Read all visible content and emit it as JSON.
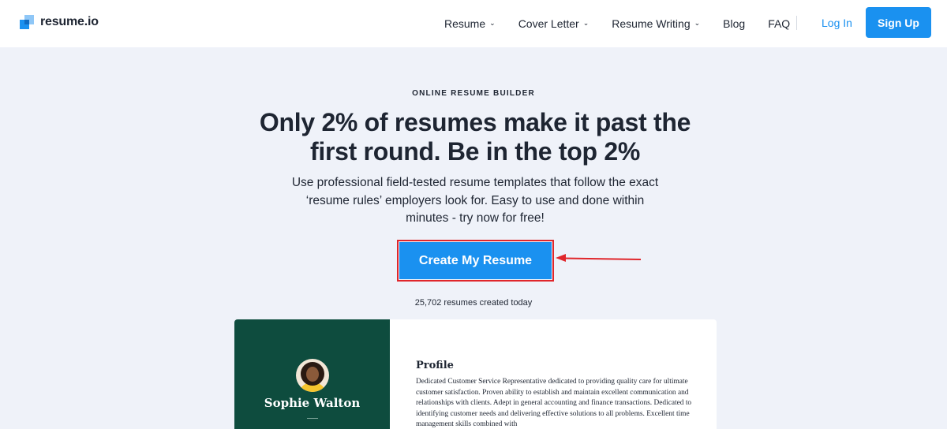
{
  "brand": {
    "name": "resume.io"
  },
  "nav": {
    "items": [
      {
        "label": "Resume",
        "has_dropdown": true
      },
      {
        "label": "Cover Letter",
        "has_dropdown": true
      },
      {
        "label": "Resume Writing",
        "has_dropdown": true
      },
      {
        "label": "Blog",
        "has_dropdown": false
      },
      {
        "label": "FAQ",
        "has_dropdown": false
      }
    ],
    "login_label": "Log In",
    "signup_label": "Sign Up"
  },
  "hero": {
    "eyebrow": "ONLINE RESUME BUILDER",
    "headline": "Only 2% of resumes make it past the first round. Be in the top 2%",
    "subtext": "Use professional field-tested resume templates that follow the exact ‘resume rules’ employers look for. Easy to use and done within minutes - try now for free!",
    "cta_label": "Create My Resume",
    "counter_text": "25,702 resumes created today"
  },
  "preview": {
    "person_name": "Sophie Walton",
    "profile_heading": "Profile",
    "profile_text": "Dedicated Customer Service Representative dedicated to providing quality care for ultimate customer satisfaction. Proven ability to establish and maintain excellent communication and relationships with clients. Adept in general accounting and finance transactions. Dedicated to identifying customer needs and delivering effective solutions to all problems. Excellent time management skills combined with"
  },
  "colors": {
    "accent": "#1a91f0",
    "page_bg": "#eff2f9",
    "highlight_border": "#e0262b",
    "resume_sidebar": "#0e4c3e"
  },
  "icons": {
    "logo": "resume-io-logo-icon",
    "dropdown": "chevron-down-icon",
    "annotation": "red-arrow-icon"
  }
}
